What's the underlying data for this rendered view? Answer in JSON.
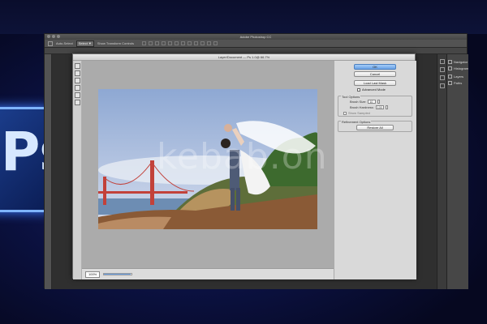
{
  "brand": {
    "logo_text": "Ps"
  },
  "window": {
    "title": "Adobe Photoshop CC"
  },
  "options_bar": {
    "tool_label": "Auto-Select",
    "layer_label": "Select ▼",
    "transform_label": "Show Transform Controls"
  },
  "right_panels": [
    {
      "label": "Navigator"
    },
    {
      "label": "Histogram"
    },
    {
      "label": "Layers"
    },
    {
      "label": "Paths"
    }
  ],
  "dialog": {
    "title": "Layer/Document — Ps 1.0@ 66.7%",
    "buttons": {
      "ok": "OK",
      "cancel": "Cancel",
      "load": "Load Last Mask",
      "reset": "Restore All"
    },
    "checkbox_advanced": "Advanced Mode",
    "tool_options_group": {
      "label": "Tool Options",
      "brush_size_label": "Brush Size:",
      "brush_size_value": "10",
      "brush_hardness_label": "Brush Hardness:",
      "brush_hardness_value": "100",
      "checkbox": "Show Sampled"
    },
    "refinement_group": {
      "label": "Refinement Options"
    },
    "status": {
      "zoom": "100%",
      "progress_fraction": 0.95
    }
  },
  "photo": {
    "watermark": "kebab.on",
    "colors": {
      "sky_top": "#9fb6da",
      "sky_bottom": "#c9d5ea",
      "bridge": "#c2413a",
      "water": "#6d8db3",
      "ground": "#8a5a36",
      "grass": "#3d6a2e"
    }
  }
}
